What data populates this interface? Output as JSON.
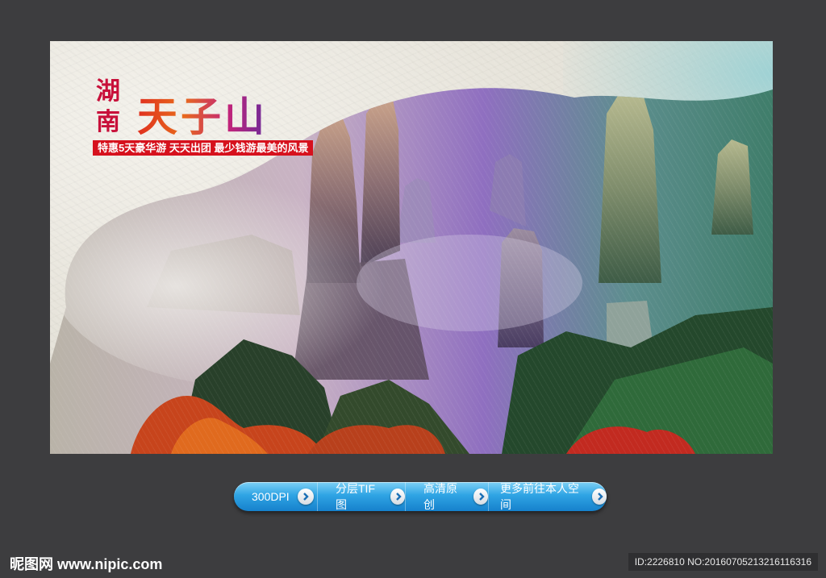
{
  "poster": {
    "title_side_1": "湖",
    "title_side_2": "南",
    "title_main": "天子山",
    "tagline": "特惠5天豪华游  天天出团  最少钱游最美的风景"
  },
  "buttons": [
    {
      "label": "300DPI",
      "icon": "arrow-right-icon"
    },
    {
      "label": "分层TIF图",
      "icon": "arrow-right-icon"
    },
    {
      "label": "高清原创",
      "icon": "arrow-right-icon"
    },
    {
      "label": "更多前往本人空间",
      "icon": "arrow-right-icon"
    }
  ],
  "footer": {
    "logo": "昵图网 www.nipic.com",
    "id_text": "ID:2226810 NO:20160705213216116316"
  },
  "colors": {
    "background": "#3d3d3f",
    "title_red": "#c8103a",
    "tagline_bg": "#d6111d",
    "button_blue": "#1f8fd8"
  }
}
